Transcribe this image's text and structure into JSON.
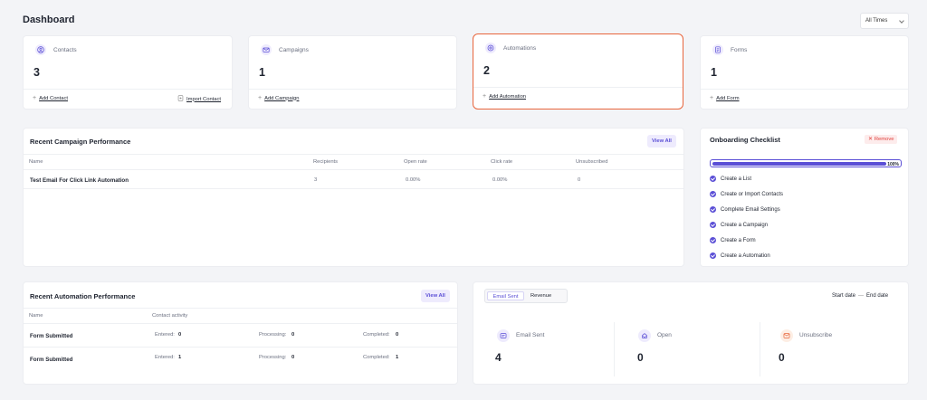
{
  "page": {
    "title": "Dashboard"
  },
  "filter": {
    "time_range": "All Times"
  },
  "stats": {
    "contacts": {
      "label": "Contacts",
      "count": "3",
      "action1": "Add Contact",
      "action2": "Import Contact",
      "icon": "user-circle-icon"
    },
    "campaigns": {
      "label": "Campaigns",
      "count": "1",
      "action1": "Add Campaign",
      "icon": "mail-send-icon"
    },
    "automations": {
      "label": "Automations",
      "count": "2",
      "action1": "Add Automation",
      "icon": "automation-icon",
      "highlight_color": "#e8663d"
    },
    "forms": {
      "label": "Forms",
      "count": "1",
      "action1": "Add Form",
      "icon": "form-icon"
    }
  },
  "campaign_perf": {
    "title": "Recent Campaign Performance",
    "view_all": "View All",
    "columns": [
      "Name",
      "Recipients",
      "Open rate",
      "Click rate",
      "Unsubscribed"
    ],
    "rows": [
      {
        "name": "Test Email For Click Link Automation",
        "recipients": "3",
        "open_rate": "0.00%",
        "click_rate": "0.00%",
        "unsubscribed": "0"
      }
    ]
  },
  "onboarding": {
    "title": "Onboarding Checklist",
    "remove": "Remove",
    "progress_percent": 100,
    "progress_label": "100%",
    "items": [
      "Create a List",
      "Create or Import Contacts",
      "Complete Email Settings",
      "Create a Campaign",
      "Create a Form",
      "Create a Automation"
    ]
  },
  "automation_perf": {
    "title": "Recent Automation Performance",
    "view_all": "View All",
    "columns": [
      "Name",
      "Contact activity"
    ],
    "entered_label": "Entered:",
    "processing_label": "Processing:",
    "completed_label": "Completed:",
    "rows": [
      {
        "name": "Form Submitted",
        "entered": "0",
        "processing": "0",
        "completed": "0"
      },
      {
        "name": "Form Submitted",
        "entered": "1",
        "processing": "0",
        "completed": "1"
      }
    ]
  },
  "email_stats": {
    "tabs": [
      "Email Sent",
      "Revenue"
    ],
    "active_tab": "Email Sent",
    "start_date": "Start date",
    "arrow": "—",
    "end_date": "End date",
    "metrics": [
      {
        "label": "Email Sent",
        "value": "4",
        "icon": "email-sent-icon"
      },
      {
        "label": "Open",
        "value": "0",
        "icon": "open-icon"
      },
      {
        "label": "Unsubscribe",
        "value": "0",
        "icon": "unsubscribe-icon"
      }
    ]
  },
  "colors": {
    "accent": "#5b4fd6",
    "highlight": "#e8663d",
    "danger": "#e0403b",
    "background": "#f3f4f7"
  }
}
